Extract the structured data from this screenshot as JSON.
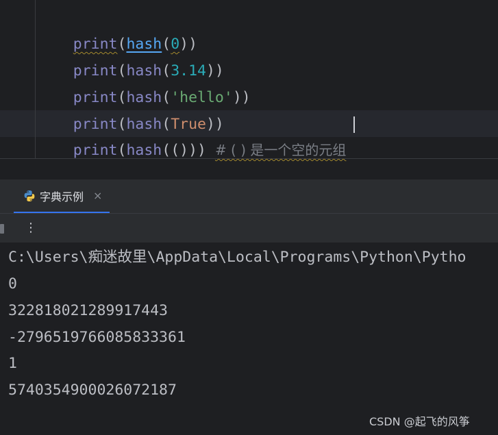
{
  "editor": {
    "lines": [
      {
        "builtin": "print",
        "open": "(",
        "fn": "hash",
        "open2": "(",
        "arg": "0",
        "close": "))"
      },
      {
        "builtin": "print",
        "open": "(",
        "fn": "hash",
        "open2": "(",
        "arg": "3.14",
        "close": "))"
      },
      {
        "builtin": "print",
        "open": "(",
        "fn": "hash",
        "open2": "(",
        "arg": "'hello'",
        "close": "))"
      },
      {
        "builtin": "print",
        "open": "(",
        "fn": "hash",
        "open2": "(",
        "arg": "True",
        "close": "))"
      },
      {
        "builtin": "print",
        "open": "(",
        "fn": "hash",
        "open2": "(",
        "arg": "()",
        "close": "))",
        "comment": "# ( ) 是一个空的元组"
      }
    ]
  },
  "run_panel": {
    "tab_label": "字典示例",
    "tab_close": "×",
    "tab_icon": "python-icon",
    "toolbar_icons": [
      "stop-icon",
      "more-vertical-icon"
    ],
    "more_glyph": "⋮"
  },
  "console": {
    "lines": [
      "C:\\Users\\痴迷故里\\AppData\\Local\\Programs\\Python\\Pytho",
      "0",
      "322818021289917443",
      "-2796519766085833361",
      "1",
      "5740354900026072187"
    ]
  },
  "watermark": "CSDN @起飞的风筝"
}
